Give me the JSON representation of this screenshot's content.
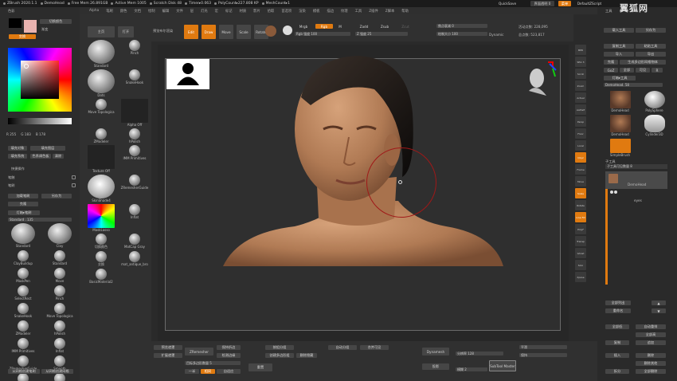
{
  "window": {
    "title": "ZBrush 2020.1.1",
    "doc": "DemoHead",
    "free_mem": "Free Mem 26.891GB",
    "active_mem": "Active Mem 1005",
    "scratch": "Scratch Disk 48",
    "timer": "Timer▸0.063",
    "polycount": "PolyCount▸227.808 KP",
    "meshcount": "MeshCount▸1",
    "quicksave": "QuickSave",
    "transparency": "界面透明 0",
    "menu": "菜单",
    "script": "DefaultZScript",
    "watermark": "翼狐网"
  },
  "menus": [
    "Alpha",
    "笔刷",
    "颜色",
    "文档",
    "绘制",
    "编辑",
    "文件",
    "层",
    "灯光",
    "宏",
    "标记",
    "材质",
    "影片",
    "拾取",
    "首选项",
    "渲染",
    "模板",
    "描边",
    "纹理",
    "工具",
    "Z插件",
    "Z脚本",
    "帮助"
  ],
  "left_panel": {
    "header": "色彩",
    "switch_color": "切换颜色",
    "gradient": "渐变",
    "swatch_label": "交换",
    "rgb": [
      "R 255",
      "G 183",
      "B 178"
    ],
    "fill_object": "填充对象",
    "fill_layer": "填充图层",
    "sys_fill": "填充系统",
    "color_picker": "色系调色板",
    "clear": "清除",
    "section_macro": "快捷操作",
    "brush_section": "笔触",
    "brush_section2": "笔刷",
    "load_brush": "加载笔刷",
    "save_as": "另存为",
    "clone": "克隆",
    "lightbox_brush": "灯箱▸笔刷",
    "standard_slider": "Standard . 135",
    "brushes": [
      "Standard",
      "Clay",
      "ClayBuildup",
      "Standard",
      "MaskPen",
      "Move",
      "SelectRect",
      "Pinch",
      "SnakeHook",
      "Move Topologica",
      "ZModeler",
      "hPolish",
      "IMM Primitives",
      "Inflat",
      "ZRemesherGuide",
      "Smooth",
      "Move",
      "Smooth"
    ],
    "create_brush": "从网格创建笔刷",
    "create_brush2": "从网格创建网格"
  },
  "tool_shelf": {
    "home": "主页",
    "open": "打开",
    "preview": "预览布尔渲染",
    "items": [
      "Standard",
      "Pinch",
      "Dots",
      "SnakeHook",
      "Move Topologica",
      "Alpha Off",
      "ZModeler",
      "hPolish",
      "Texture Off",
      "IMM Primitives",
      "SkinShade4",
      "ZRemesherGuide",
      "MaskLasso",
      "Inflat",
      "切换颜色",
      "MatCap Gray",
      "交换",
      "mat_antique_bro",
      "BasicMaterial2"
    ],
    "gradient": "渐变"
  },
  "top_tools": {
    "edit": "Edit",
    "draw": "Draw",
    "move": "Move",
    "scale": "Scale",
    "rotate": "Rotate",
    "mrgb": "Mrgb",
    "rgb": "Rgb",
    "m": "M",
    "rgb_intensity": "Rgb 强度 100",
    "zadd": "Zadd",
    "zsub": "Zsub",
    "zcut": "Zcut",
    "z_intensity": "Z 强度 25",
    "focal_shift": "焦点衰减 0",
    "draw_size": "绘制大小 100",
    "dynamic": "Dynamic",
    "active_points": "活动点数: 228,095",
    "total_points": "总点数: 523,817"
  },
  "bottom_bar": {
    "preview_mesh": "预览遮罩",
    "expand_mesh": "扩展遮罩",
    "zremesher": "ZRemesher",
    "keep_groups": "保持折边",
    "detect_edges": "检测边缘",
    "target_poly": "目标多边形数量 5",
    "half": "一半",
    "same": "相同",
    "adapt": "自适应",
    "polygroup": "按组分组",
    "create_group": "创建多边形组",
    "delete_hidden": "删除隐藏",
    "reset": "重置",
    "auto_group": "自动分组",
    "merge_vis": "合并可见",
    "dynamesh": "Dynamesh",
    "resolution": "分辨率 128",
    "blur": "模糊 2",
    "project": "投影",
    "sub_tool_master": "SubTool Master",
    "smooth": "平滑",
    "keep": "保持"
  },
  "right_icons": [
    "BPR",
    "SPix 3",
    "Scroll",
    "Zoom",
    "Actual",
    "AAHalf",
    "Persp",
    "Floor",
    "Local",
    "Qxyz",
    "Frame",
    "Move",
    "Scale",
    "Rotate",
    "Line Fill",
    "PolyF",
    "Transp",
    "Ghost",
    "Solo",
    "Xpose"
  ],
  "right_panel": {
    "tool_header": "工具",
    "load_tool": "载入工具",
    "save_as": "另存为",
    "copy_tool": "复制工具",
    "paste_tool": "粘贴工具",
    "import": "导入",
    "export": "导出",
    "clone": "克隆",
    "make_polymesh": "生成多边形网格物体",
    "goz": "GoZ",
    "all": "全部",
    "visible": "可见",
    "r": "R",
    "lightbox_tool": "灯箱▸工具",
    "demohead_slider": "DemoHead. 58",
    "tools": [
      "DemoHead",
      "PolySphere",
      "DemoHead",
      "Cylinder3D",
      "SimpleBrush"
    ],
    "subtool_header": "子工具",
    "subtool_count": "子工具可见数量 8",
    "subtools": [
      "DemoHead",
      "eyes"
    ],
    "list_all": "全部列出",
    "rename": "重命名",
    "auto_reorder": "自动重排",
    "all_low": "全部低",
    "all_high": "全部高",
    "copy": "复制",
    "append": "追加",
    "insert": "插入",
    "delete": "删除",
    "del_other": "删除其他",
    "del_all": "全部删除",
    "split": "拆分",
    "merge": "合并",
    "fill": "填充",
    "dup": "复制"
  }
}
